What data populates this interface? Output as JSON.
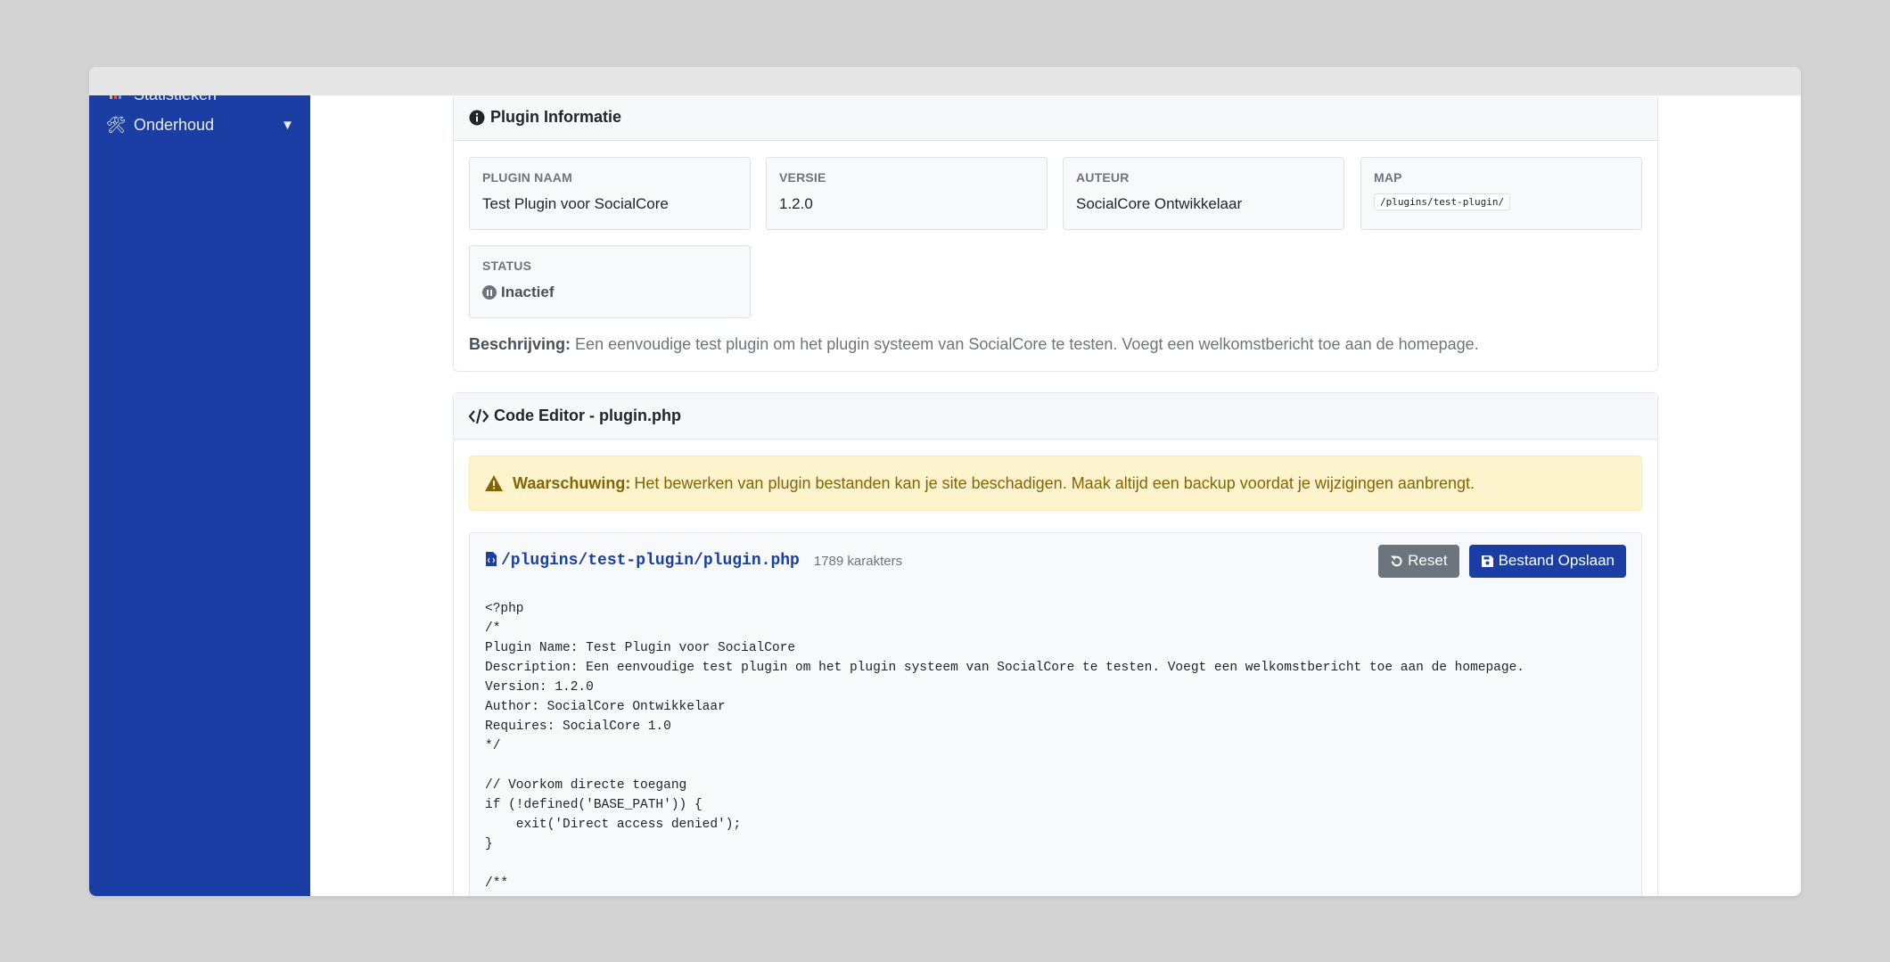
{
  "sidebar": {
    "items": [
      {
        "label": "Statistieken",
        "icon": "chart-icon"
      },
      {
        "label": "Onderhoud",
        "icon": "tools-icon",
        "chevron": "▼"
      }
    ]
  },
  "plugin_info": {
    "title": "Plugin Informatie",
    "name_label": "PLUGIN NAAM",
    "name_value": "Test Plugin voor SocialCore",
    "version_label": "VERSIE",
    "version_value": "1.2.0",
    "author_label": "AUTEUR",
    "author_value": "SocialCore Ontwikkelaar",
    "folder_label": "MAP",
    "folder_value": "/plugins/test-plugin/",
    "status_label": "STATUS",
    "status_value": "Inactief",
    "description_label": "Beschrijving:",
    "description_value": "Een eenvoudige test plugin om het plugin systeem van SocialCore te testen. Voegt een welkomstbericht toe aan de homepage."
  },
  "editor": {
    "title": "Code Editor - plugin.php",
    "warning_label": "Waarschuwing:",
    "warning_text": "Het bewerken van plugin bestanden kan je site beschadigen. Maak altijd een backup voordat je wijzigingen aanbrengt.",
    "file_path": "/plugins/test-plugin/plugin.php",
    "char_count": "1789 karakters",
    "reset_label": "Reset",
    "save_label": "Bestand Opslaan",
    "code": "<?php\n/*\nPlugin Name: Test Plugin voor SocialCore\nDescription: Een eenvoudige test plugin om het plugin systeem van SocialCore te testen. Voegt een welkomstbericht toe aan de homepage.\nVersion: 1.2.0\nAuthor: SocialCore Ontwikkelaar\nRequires: SocialCore 1.0\n*/\n\n// Voorkom directe toegang\nif (!defined('BASE_PATH')) {\n    exit('Direct access denied');\n}\n\n/**"
  },
  "colors": {
    "sidebar": "#1a3ea3",
    "primary": "#1a3ea3",
    "warning_bg": "#fdf3cd",
    "warning_text": "#856404",
    "muted": "#6c757d"
  }
}
